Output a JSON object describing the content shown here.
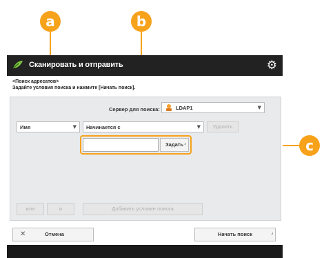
{
  "callouts": {
    "a": "a",
    "b": "b",
    "c": "c"
  },
  "title": "Сканировать и отправить",
  "instructions": {
    "line1": "<Поиск адресатов>",
    "line2": "Задайте условия поиска и нажмите [Начать поиск]."
  },
  "server": {
    "label": "Сервер для поиска:",
    "value": "LDAP1"
  },
  "attribute_select": {
    "value": "Имя"
  },
  "condition_select": {
    "value": "Начинается с"
  },
  "delete_button": "Удалить",
  "set_button": "Задать",
  "search_text": {
    "value": ""
  },
  "bottom_row": {
    "btn1": "или",
    "btn2": "и",
    "add_condition": "Добавить условие поиска"
  },
  "cancel_button": "Отмена",
  "start_search_button": "Начать поиск",
  "colors": {
    "accent": "#f7a21b",
    "titlebar": "#222222"
  }
}
